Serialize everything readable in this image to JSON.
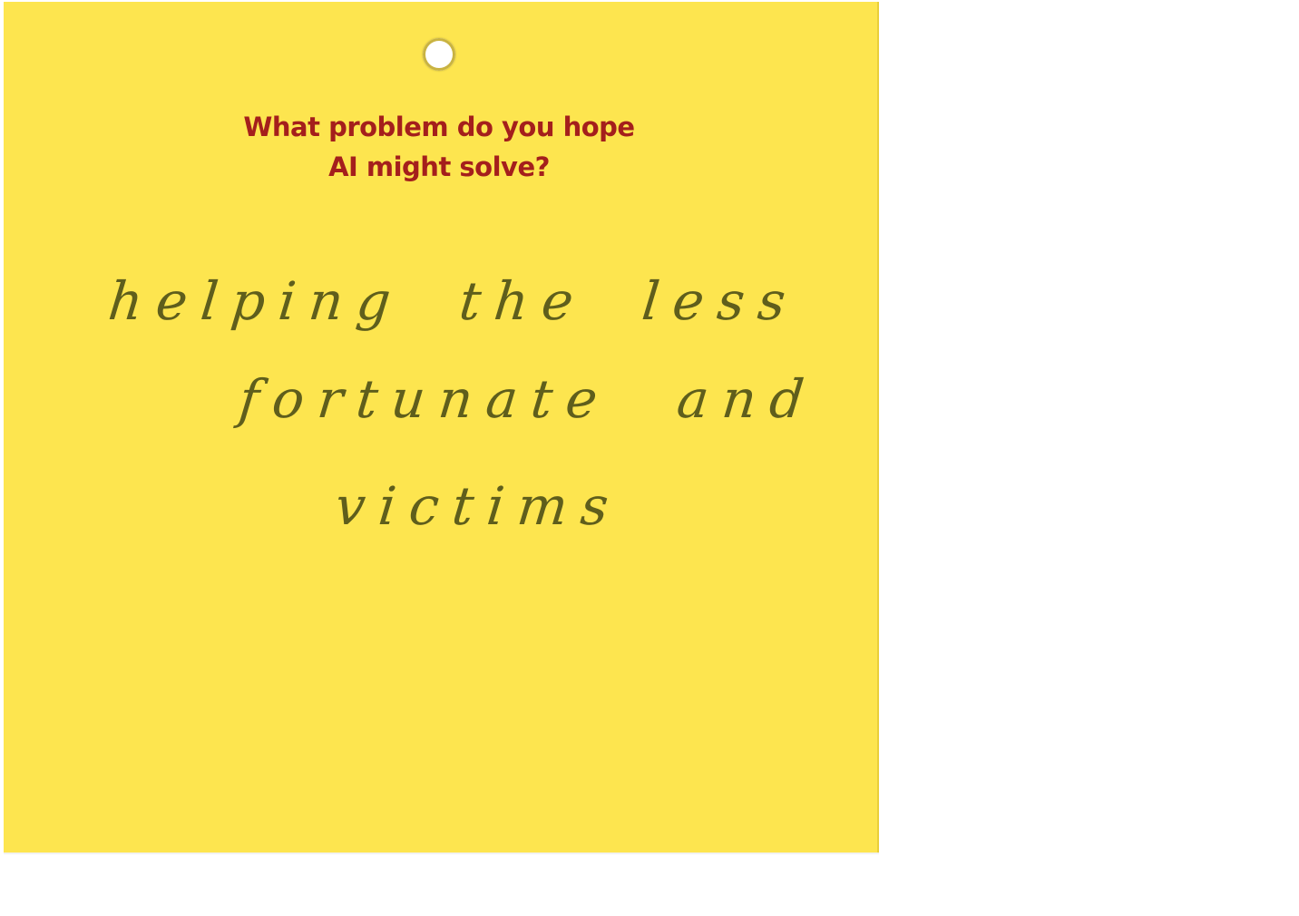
{
  "card": {
    "question_line1": "What problem do you hope",
    "question_line2": "AI might solve?",
    "answer_line1": "helping the less",
    "answer_line2": "fortunate and",
    "answer_line3": "victims",
    "colors": {
      "card": "#fde54f",
      "question_text": "#a41f1c",
      "handwriting": "#5f5e1c"
    }
  }
}
